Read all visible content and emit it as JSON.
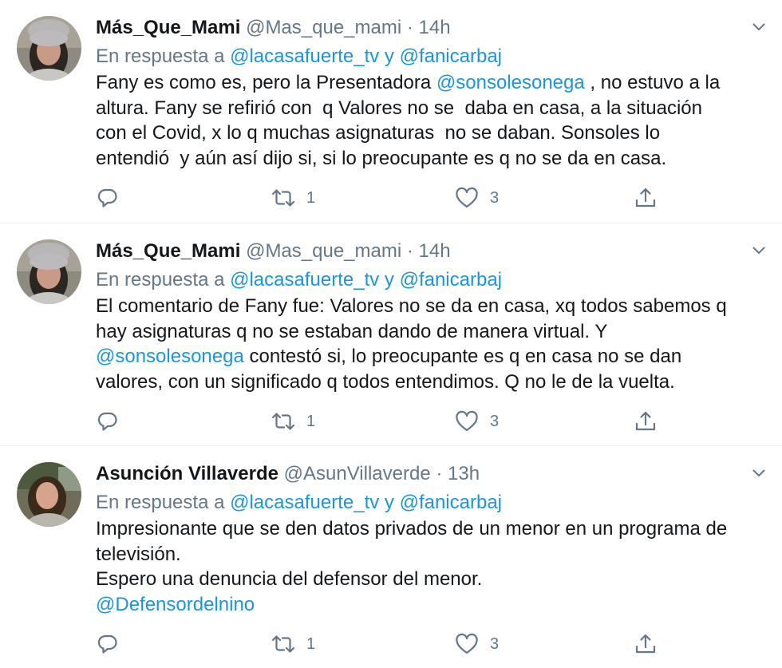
{
  "tweets": [
    {
      "name": "Más_Que_Mami",
      "handle": "@Mas_que_mami",
      "sep": " · ",
      "time": "14h",
      "reply_prefix": "En respuesta a ",
      "reply_to_1": "@lacasafuerte_tv",
      "reply_join": " y ",
      "reply_to_2": "@fanicarbaj",
      "lines": [
        {
          "a": "Fany es como es, pero la Presentadora ",
          "m": "@sonsolesonega",
          "b": " , no estuvo a la"
        },
        {
          "a": "altura. Fany se refirió con  q Valores no se  daba en casa, a la situación"
        },
        {
          "a": "con el Covid, x lo q muchas asignaturas  no se daban. Sonsoles lo"
        },
        {
          "a": "entendió  y aún así dijo si, si lo preocupante es q no se da en casa."
        }
      ],
      "retweets": "1",
      "likes": "3"
    },
    {
      "name": "Más_Que_Mami",
      "handle": "@Mas_que_mami",
      "sep": " · ",
      "time": "14h",
      "reply_prefix": "En respuesta a ",
      "reply_to_1": "@lacasafuerte_tv",
      "reply_join": " y ",
      "reply_to_2": "@fanicarbaj",
      "lines": [
        {
          "a": "El comentario de Fany fue: Valores no se da en casa, xq todos sabemos q"
        },
        {
          "a": "hay asignaturas q no se estaban dando de manera virtual. Y"
        },
        {
          "m": "@sonsolesonega",
          "b": " contestó si, lo preocupante es q en casa no se dan"
        },
        {
          "a": "valores, con un significado q todos entendimos. Q no le de la vuelta."
        }
      ],
      "retweets": "1",
      "likes": "3"
    },
    {
      "name": "Asunción Villaverde",
      "handle": "@AsunVillaverde",
      "sep": " · ",
      "time": "13h",
      "reply_prefix": "En respuesta a ",
      "reply_to_1": "@lacasafuerte_tv",
      "reply_join": " y ",
      "reply_to_2": "@fanicarbaj",
      "lines": [
        {
          "a": "Impresionante que se den datos privados de un menor en un programa de"
        },
        {
          "a": "televisión."
        },
        {
          "a": "Espero una denuncia del defensor del menor."
        },
        {
          "m": "@Defensordelnino"
        }
      ],
      "retweets": "1",
      "likes": "3"
    }
  ],
  "icons": {
    "reply": "reply-icon",
    "retweet": "retweet-icon",
    "like": "heart-icon",
    "share": "share-icon",
    "menu": "chevron-down-icon"
  },
  "colors": {
    "text": "#14171a",
    "secondary": "#657786",
    "link": "#1b95e0",
    "divider": "#e6ecf0"
  }
}
